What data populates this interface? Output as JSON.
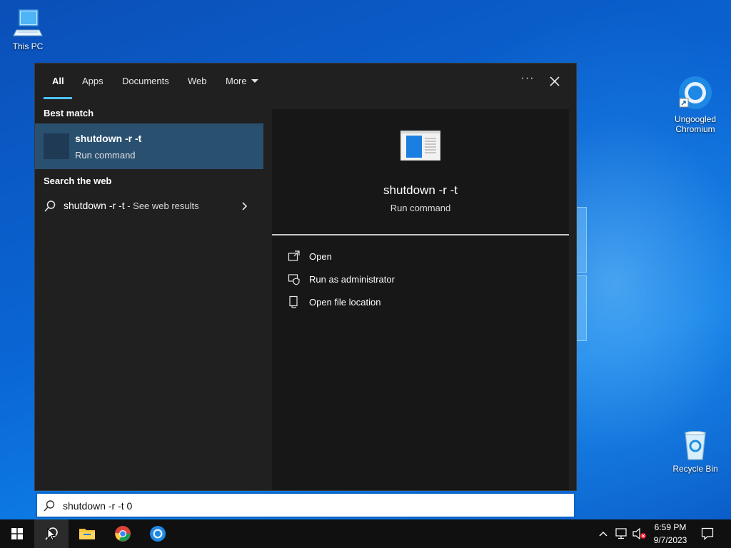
{
  "desktop": {
    "icons": {
      "this_pc": "This PC",
      "chromium_line1": "Ungoogled",
      "chromium_line2": "Chromium",
      "recycle_bin": "Recycle Bin"
    }
  },
  "search_panel": {
    "tabs": [
      {
        "label": "All",
        "active": true
      },
      {
        "label": "Apps"
      },
      {
        "label": "Documents"
      },
      {
        "label": "Web"
      },
      {
        "label": "More"
      }
    ],
    "best_match": {
      "section_title": "Best match",
      "title": "shutdown -r -t",
      "subtitle": "Run command"
    },
    "web": {
      "section_title": "Search the web",
      "query": "shutdown -r -t",
      "suffix": " - See web results"
    },
    "preview": {
      "title": "shutdown -r -t",
      "subtitle": "Run command",
      "actions": [
        {
          "label": "Open",
          "icon": "open-icon"
        },
        {
          "label": "Run as administrator",
          "icon": "admin-shield-icon"
        },
        {
          "label": "Open file location",
          "icon": "file-location-icon"
        }
      ]
    }
  },
  "search_box": {
    "value": "shutdown -r -t 0"
  },
  "taskbar": {
    "clock_time": "6:59 PM",
    "clock_date": "9/7/2023"
  },
  "colors": {
    "accent": "#4cc2ff",
    "selected_item": "#2a5070",
    "panel_bg": "#202020"
  }
}
